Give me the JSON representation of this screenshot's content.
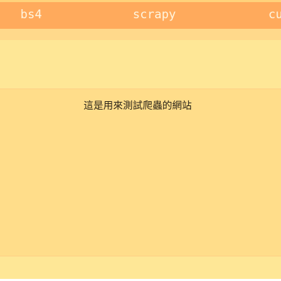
{
  "navbar": {
    "links": [
      {
        "label": "bs4"
      },
      {
        "label": "scrapy"
      },
      {
        "label": "cu"
      }
    ]
  },
  "main": {
    "text": "這是用來測試爬蟲的網站"
  },
  "colors": {
    "navbar": "#ffaa5c",
    "subbar": "#ffd98b",
    "background": "#fee796",
    "content": "#ffdd8a",
    "nav_text": "#fff6e0"
  }
}
